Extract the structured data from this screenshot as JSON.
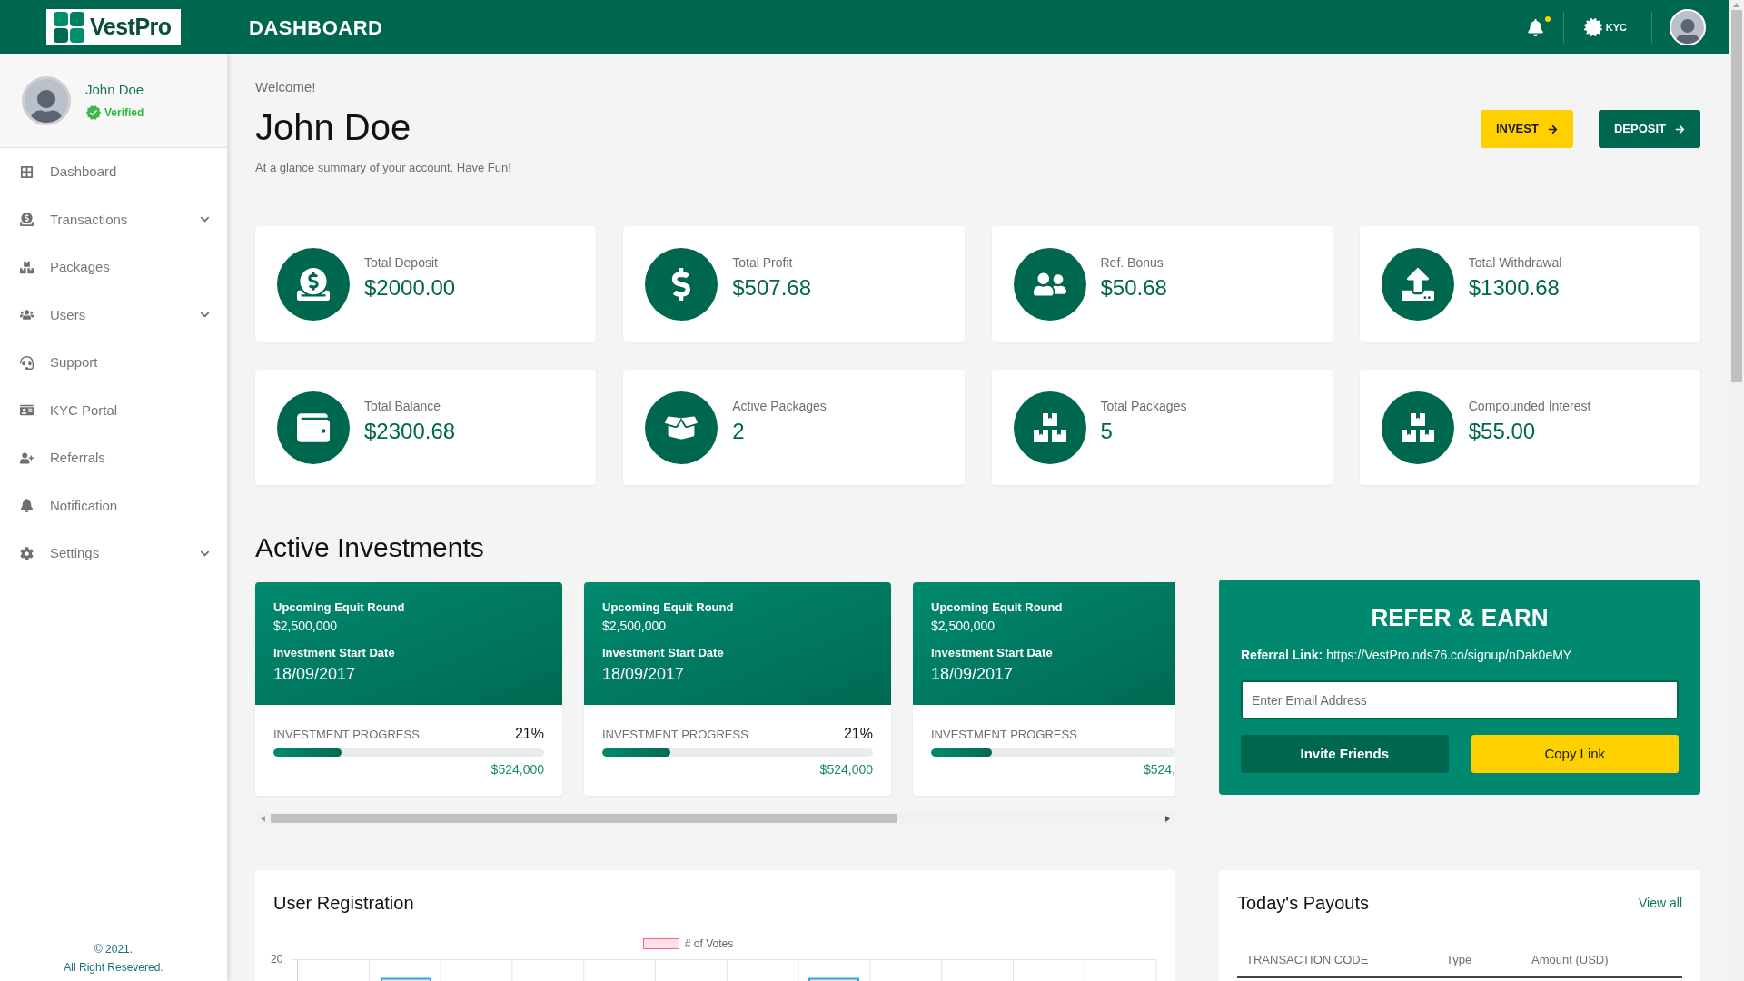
{
  "topbar": {
    "brand": "VestPro",
    "title": "DASHBOARD",
    "notifications": {
      "unread": true
    },
    "kyc_label": "KYC"
  },
  "sidebar": {
    "profile": {
      "name": "John Doe",
      "status": "Verified",
      "verified": true
    },
    "items": [
      {
        "label": "Dashboard",
        "kind": "link"
      },
      {
        "label": "Transactions",
        "kind": "group"
      },
      {
        "label": "Packages",
        "kind": "link"
      },
      {
        "label": "Users",
        "kind": "group"
      },
      {
        "label": "Support",
        "kind": "link"
      },
      {
        "label": "KYC Portal",
        "kind": "link"
      },
      {
        "label": "Referrals",
        "kind": "link"
      },
      {
        "label": "Notification",
        "kind": "link"
      },
      {
        "label": "Settings",
        "kind": "group"
      }
    ],
    "footer": {
      "copyright": "© 2021.",
      "rights": "All Right Resevered."
    }
  },
  "welcome": {
    "greeting": "Welcome!",
    "name": "John Doe",
    "subtitle": "At a glance summary of your account. Have Fun!"
  },
  "actions": [
    {
      "label": "INVEST",
      "kind": "accent"
    },
    {
      "label": "DEPOSIT",
      "kind": "primary"
    }
  ],
  "stats": [
    {
      "label": "Total Deposit",
      "value": "$2000.00"
    },
    {
      "label": "Total Profit",
      "value": "$507.68"
    },
    {
      "label": "Ref. Bonus",
      "value": "$50.68"
    },
    {
      "label": "Total Withdrawal",
      "value": "$1300.68"
    },
    {
      "label": "Total Balance",
      "value": "$2300.68"
    },
    {
      "label": "Active Packages",
      "value": "2"
    },
    {
      "label": "Total Packages",
      "value": "5"
    },
    {
      "label": "Compounded Interest",
      "value": "$55.00"
    }
  ],
  "active_investments": {
    "title": "Active Investments",
    "cards": [
      {
        "round": "Upcoming Equit Round",
        "round_amount": "$2,500,000",
        "date_label": "Investment Start Date",
        "date": "18/09/2017",
        "progress_label": "INVESTMENT PROGRESS",
        "percent": "21%",
        "level": 0.25,
        "raised": "$524,000"
      },
      {
        "round": "Upcoming Equit Round",
        "round_amount": "$2,500,000",
        "date_label": "Investment Start Date",
        "date": "18/09/2017",
        "progress_label": "INVESTMENT PROGRESS",
        "percent": "21%",
        "level": 0.25,
        "raised": "$524,000"
      },
      {
        "round": "Upcoming Equit Round",
        "round_amount": "$2,500,000",
        "date_label": "Investment Start Date",
        "date": "18/09/2017",
        "progress_label": "INVESTMENT PROGRESS",
        "level": 0.25,
        "raised": "$524,"
      }
    ]
  },
  "refer": {
    "title": "REFER & EARN",
    "link": "**Referral Link:** https://VestPro.nds76.co/signup/nDak0eMY",
    "email_placeholder": "Enter Email Address",
    "buttons": [
      {
        "label": "Invite Friends",
        "kind": "primary"
      },
      {
        "label": "Copy Link",
        "kind": "accent"
      }
    ]
  },
  "user_registration": {
    "title": "User Registration",
    "legend": "# of Votes",
    "y_tick": "20"
  },
  "payouts": {
    "title": "Today's Payouts",
    "view_all": "View all",
    "columns": [
      "TRANSACTION CODE",
      "Type",
      "Amount (USD)"
    ]
  }
}
